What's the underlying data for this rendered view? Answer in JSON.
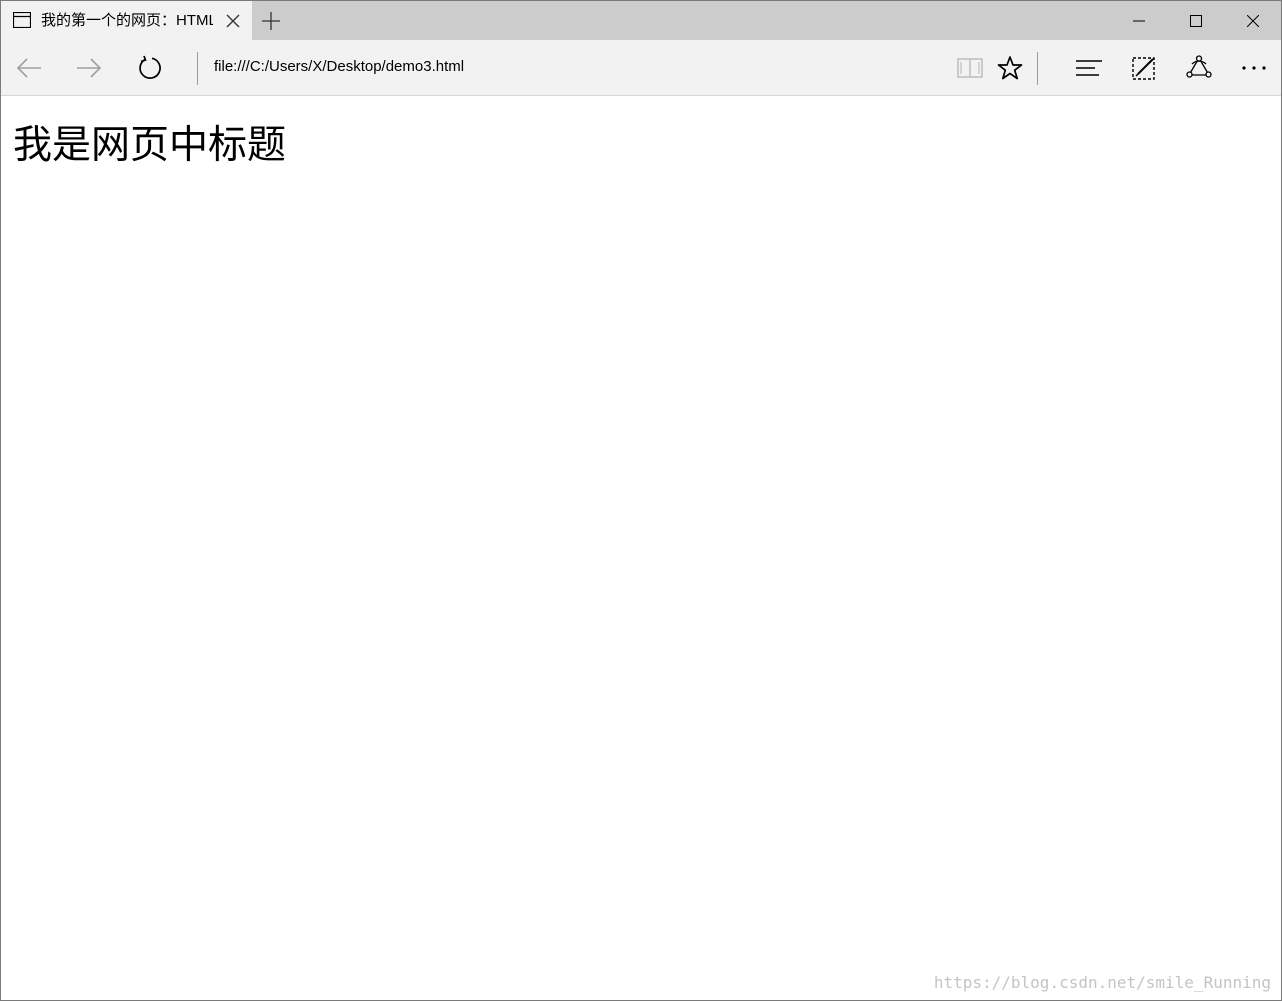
{
  "tab": {
    "title": "我的第一个的网页：HTML",
    "icon": "page-icon",
    "close_icon": "close-icon"
  },
  "toolbar": {
    "new_tab_icon": "plus-icon",
    "back_icon": "arrow-left-icon",
    "forward_icon": "arrow-right-icon",
    "refresh_icon": "refresh-icon",
    "reading_view_icon": "book-icon",
    "favorite_icon": "star-icon",
    "hub_icon": "hub-lines-icon",
    "web_note_icon": "pen-note-icon",
    "share_icon": "share-icon",
    "more_icon": "ellipsis-icon"
  },
  "window_controls": {
    "minimize_icon": "minimize-icon",
    "maximize_icon": "maximize-icon",
    "close_icon": "close-icon"
  },
  "address": {
    "url": "file:///C:/Users/X/Desktop/demo3.html"
  },
  "page": {
    "heading": "我是网页中标题"
  },
  "watermark": {
    "text": "https://blog.csdn.net/smile_Running"
  },
  "colors": {
    "tabbar_bg": "#cccccc",
    "active_tab_bg": "#f2f2f2",
    "navbar_bg": "#f2f2f2",
    "content_bg": "#ffffff",
    "disabled_icon": "#a0a0a0",
    "watermark": "#c4c4c4"
  }
}
